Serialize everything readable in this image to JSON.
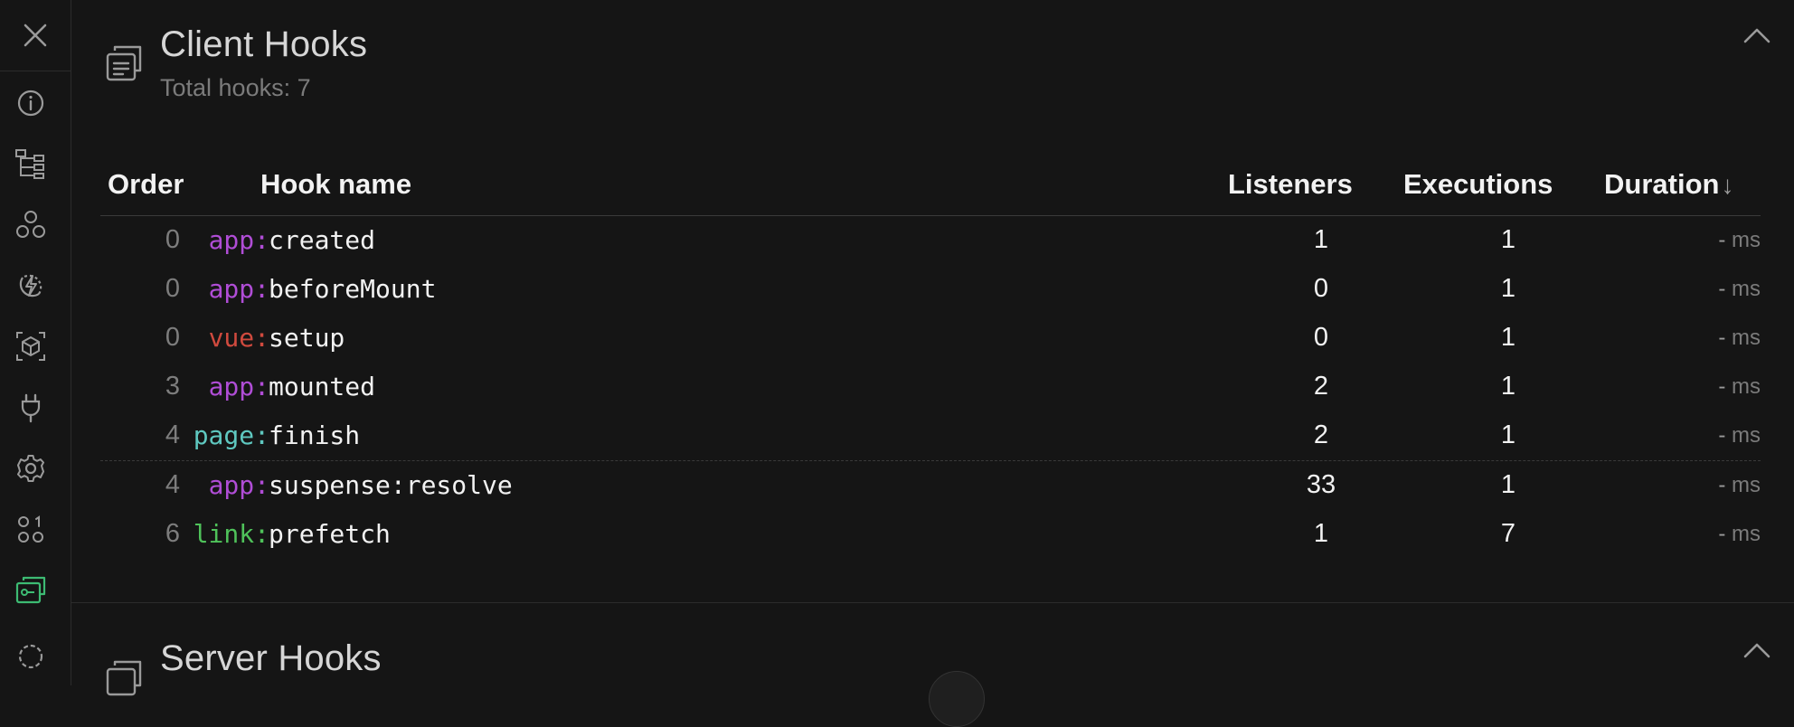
{
  "sidebar": {
    "close_icon": "close-icon",
    "items": [
      {
        "icon": "info-icon",
        "active": false
      },
      {
        "icon": "component-tree-icon",
        "active": false
      },
      {
        "icon": "components-icon",
        "active": false
      },
      {
        "icon": "nuxt-icon",
        "active": false
      },
      {
        "icon": "cube-icon",
        "active": false
      },
      {
        "icon": "plug-icon",
        "active": false
      },
      {
        "icon": "gear-icon",
        "active": false
      },
      {
        "icon": "shapes-icon",
        "active": false
      },
      {
        "icon": "hooks-icon",
        "active": true
      },
      {
        "icon": "dashed-circle-icon",
        "active": false
      }
    ],
    "active_color": "#3dbb73"
  },
  "client_hooks": {
    "title": "Client Hooks",
    "subtitle": "Total hooks: 7",
    "columns": {
      "order": "Order",
      "hook_name": "Hook name",
      "listeners": "Listeners",
      "executions": "Executions",
      "duration": "Duration",
      "sort_arrow": "↓"
    },
    "rows": [
      {
        "order": "0",
        "prefix": "app:",
        "prefix_color": "#b04dd6",
        "name": "created",
        "listeners": "1",
        "executions": "1",
        "duration_value": "-",
        "duration_unit": "ms"
      },
      {
        "order": "0",
        "prefix": "app:",
        "prefix_color": "#b04dd6",
        "name": "beforeMount",
        "listeners": "0",
        "executions": "1",
        "duration_value": "-",
        "duration_unit": "ms"
      },
      {
        "order": "0",
        "prefix": "vue:",
        "prefix_color": "#d04a3e",
        "name": "setup",
        "listeners": "0",
        "executions": "1",
        "duration_value": "-",
        "duration_unit": "ms"
      },
      {
        "order": "3",
        "prefix": "app:",
        "prefix_color": "#b04dd6",
        "name": "mounted",
        "listeners": "2",
        "executions": "1",
        "duration_value": "-",
        "duration_unit": "ms"
      },
      {
        "order": "4",
        "prefix": "page:",
        "prefix_color": "#5fc8c0",
        "name": "finish",
        "listeners": "2",
        "executions": "1",
        "duration_value": "-",
        "duration_unit": "ms"
      },
      {
        "order": "4",
        "prefix": "app:",
        "prefix_color": "#b04dd6",
        "name": "suspense:resolve",
        "listeners": "33",
        "executions": "1",
        "duration_value": "-",
        "duration_unit": "ms"
      },
      {
        "order": "6",
        "prefix": "link:",
        "prefix_color": "#4fc25a",
        "name": "prefetch",
        "listeners": "1",
        "executions": "7",
        "duration_value": "-",
        "duration_unit": "ms"
      }
    ]
  },
  "server_hooks": {
    "title": "Server Hooks"
  }
}
